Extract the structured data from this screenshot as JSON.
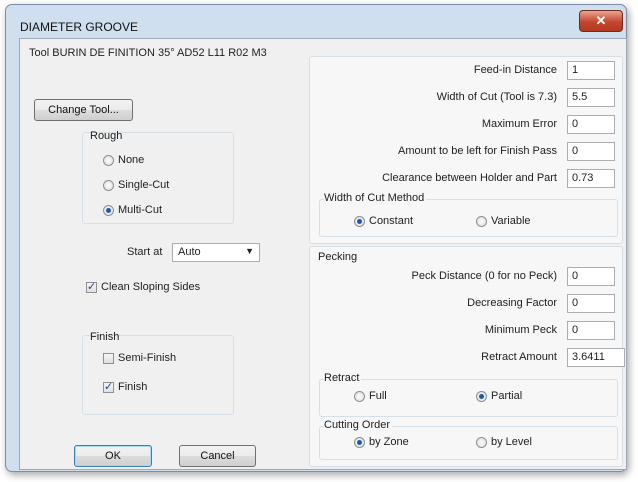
{
  "window": {
    "title": "DIAMETER GROOVE",
    "close_glyph": "✕"
  },
  "tool": {
    "label": "Tool BURIN DE FINITION 35° AD52 L11 R02 M3",
    "change_button": "Change Tool..."
  },
  "rough": {
    "title": "Rough",
    "options": [
      {
        "label": "None",
        "selected": false
      },
      {
        "label": "Single-Cut",
        "selected": false
      },
      {
        "label": "Multi-Cut",
        "selected": true
      }
    ]
  },
  "start_at": {
    "label": "Start at",
    "value": "Auto"
  },
  "clean_sloping": {
    "label": "Clean Sloping Sides",
    "checked": true
  },
  "finish": {
    "title": "Finish",
    "semi_finish": {
      "label": "Semi-Finish",
      "checked": false
    },
    "finish": {
      "label": "Finish",
      "checked": true
    }
  },
  "buttons": {
    "ok": "OK",
    "cancel": "Cancel"
  },
  "params": {
    "feed_in": {
      "label": "Feed-in Distance",
      "value": "1"
    },
    "width_of_cut": {
      "label": "Width of Cut (Tool is 7.3)",
      "value": "5.5"
    },
    "max_error": {
      "label": "Maximum Error",
      "value": "0"
    },
    "finish_pass": {
      "label": "Amount to be left for Finish Pass",
      "value": "0"
    },
    "clearance": {
      "label": "Clearance between Holder and Part",
      "value": "0.73"
    }
  },
  "width_method": {
    "title": "Width of Cut Method",
    "constant": {
      "label": "Constant",
      "selected": true
    },
    "variable": {
      "label": "Variable",
      "selected": false
    }
  },
  "pecking": {
    "title": "Pecking",
    "peck_distance": {
      "label": "Peck Distance (0 for no Peck)",
      "value": "0"
    },
    "decreasing_factor": {
      "label": "Decreasing Factor",
      "value": "0"
    },
    "minimum_peck": {
      "label": "Minimum Peck",
      "value": "0"
    },
    "retract_amount": {
      "label": "Retract Amount",
      "value": "3.6411"
    }
  },
  "retract": {
    "title": "Retract",
    "full": {
      "label": "Full",
      "selected": false
    },
    "partial": {
      "label": "Partial",
      "selected": true
    }
  },
  "cutting_order": {
    "title": "Cutting Order",
    "by_zone": {
      "label": "by Zone",
      "selected": true
    },
    "by_level": {
      "label": "by Level",
      "selected": false
    }
  },
  "colors": {
    "frame": "#cfdff0",
    "client": "#f0f0f0",
    "close": "#c4452d",
    "accent": "#1b58b8"
  }
}
